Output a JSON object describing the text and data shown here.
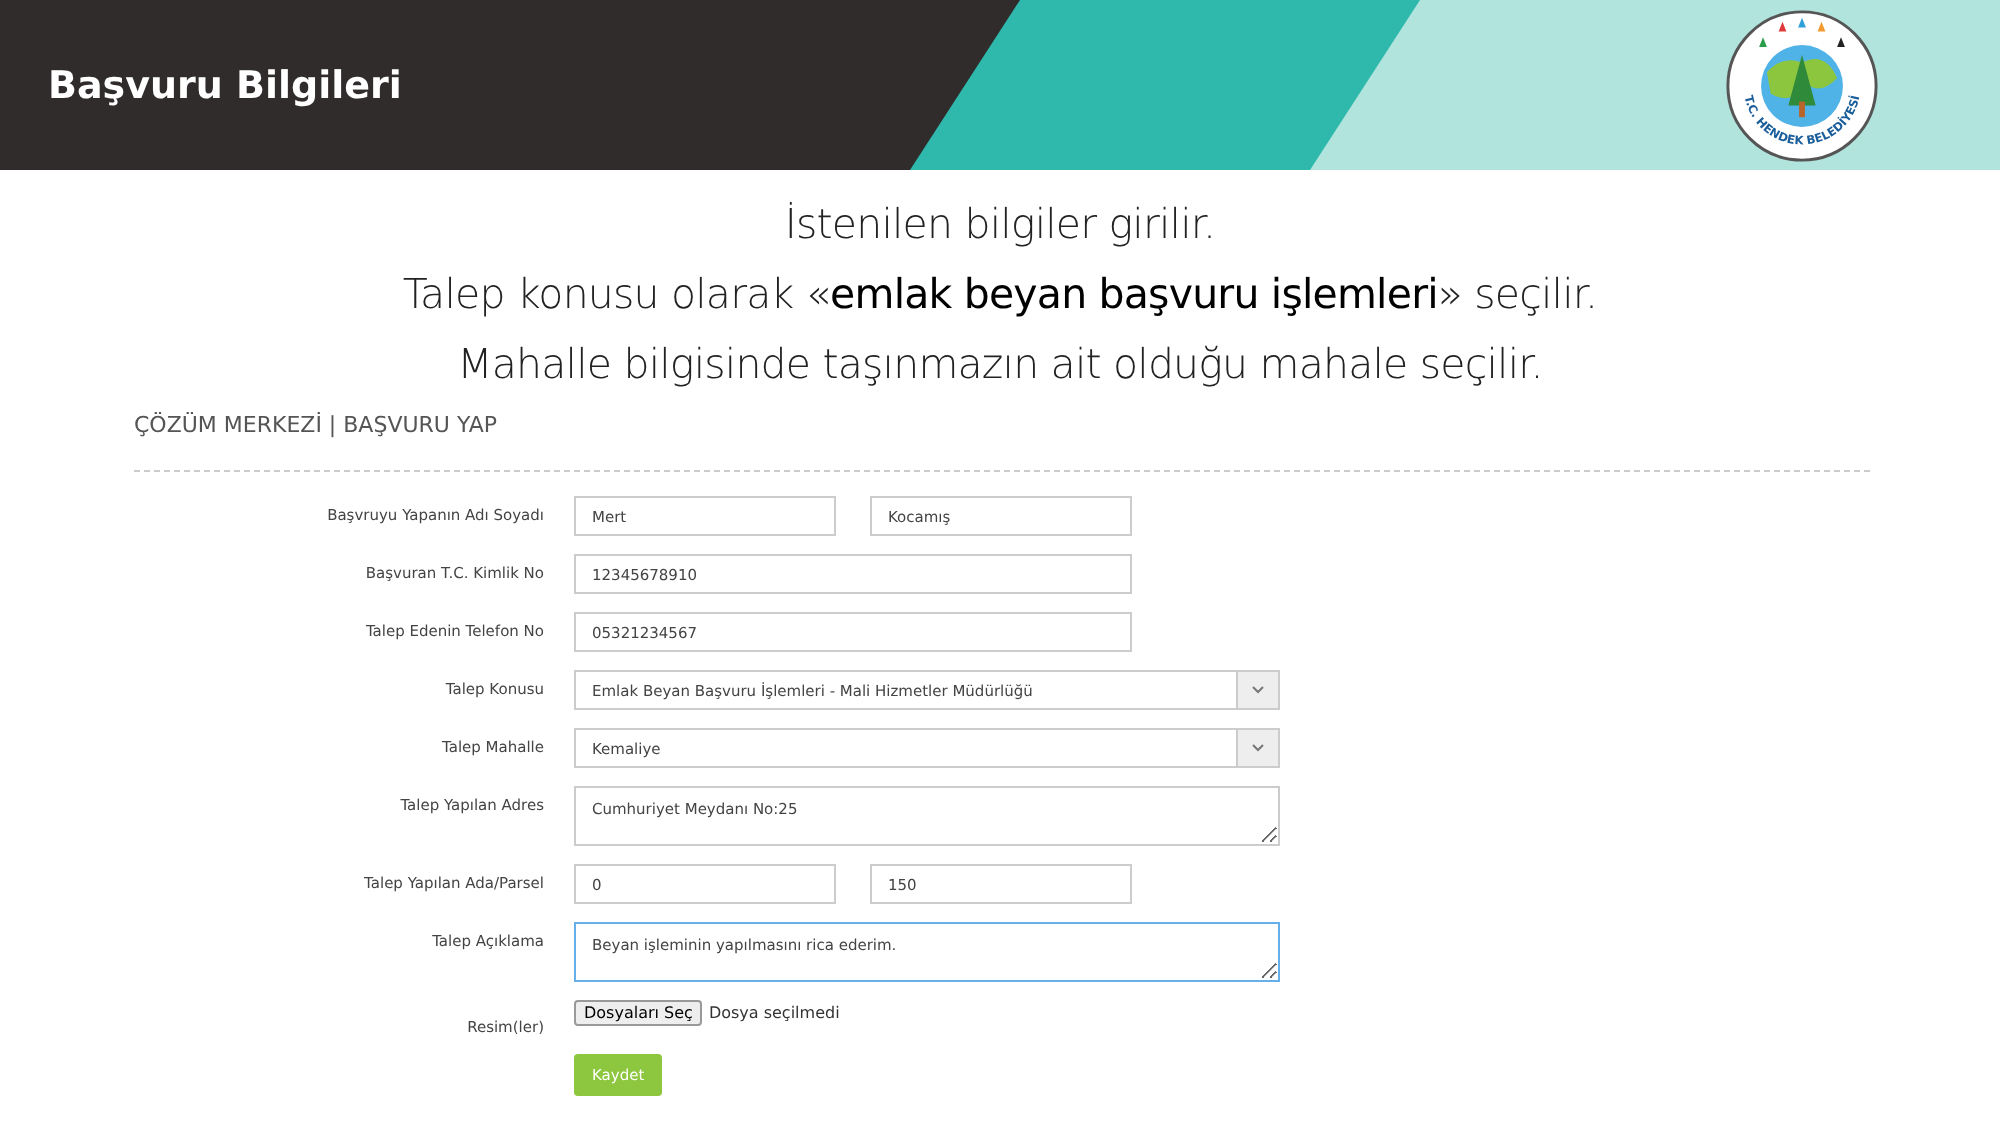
{
  "header": {
    "title": "Başvuru Bilgileri",
    "logo_text": "T.C. HENDEK BELEDİYESİ"
  },
  "instructions": [
    "İstenilen bilgiler girilir.",
    "Talep konusu olarak «**emlak beyan başvuru işlemleri**» seçilir.",
    "Mahalle bilgisinde taşınmazın ait olduğu mahale seçilir."
  ],
  "form": {
    "breadcrumb": "ÇÖZÜM MERKEZİ | BAŞVURU YAP",
    "fields": [
      {
        "kind": "double",
        "label": "Başvruyu Yapanın Adı Soyadı",
        "values": [
          "Mert",
          "Kocamış"
        ]
      },
      {
        "kind": "text",
        "label": "Başvuran T.C. Kimlik No",
        "value": "12345678910"
      },
      {
        "kind": "text",
        "label": "Talep Edenin Telefon No",
        "value": "05321234567"
      },
      {
        "kind": "select",
        "label": "Talep Konusu",
        "value": "Emlak Beyan Başvuru İşlemleri - Mali Hizmetler Müdürlüğü"
      },
      {
        "kind": "select",
        "label": "Talep Mahalle",
        "value": "Kemaliye"
      },
      {
        "kind": "textarea",
        "label": "Talep Yapılan Adres",
        "value": "Cumhuriyet Meydanı No:25",
        "focused": false
      },
      {
        "kind": "double",
        "label": "Talep Yapılan Ada/Parsel",
        "values": [
          "0",
          "150"
        ]
      },
      {
        "kind": "textarea",
        "label": "Talep Açıklama",
        "value": "Beyan işleminin yapılmasını rica ederim.",
        "focused": true
      },
      {
        "kind": "file",
        "label": "Resim(ler)",
        "button": "Dosyaları Seç",
        "status": "Dosya seçilmedi"
      }
    ],
    "submit": "Kaydet"
  }
}
